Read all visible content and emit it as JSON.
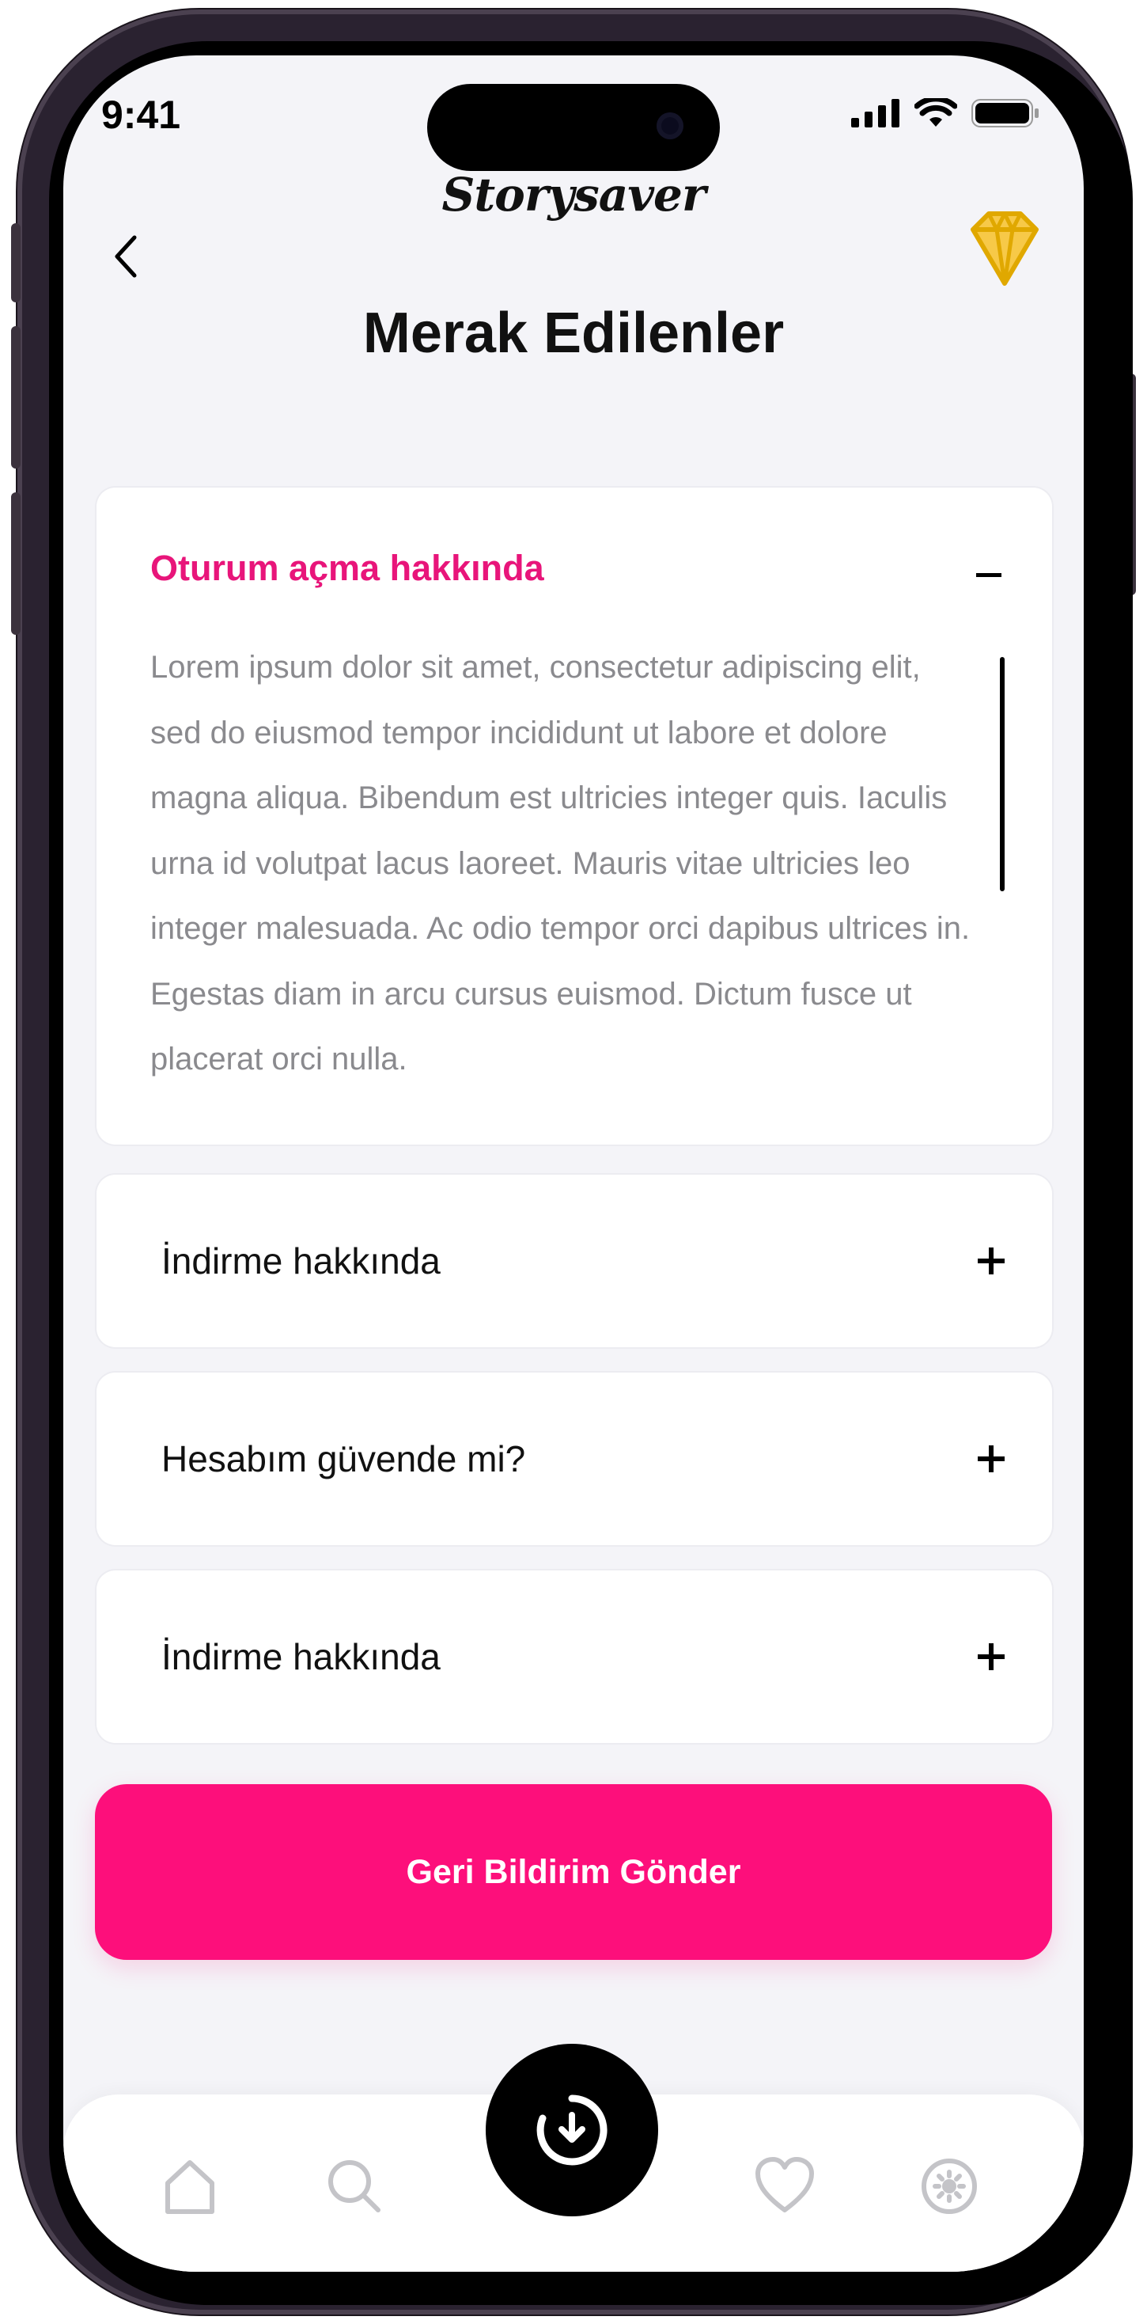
{
  "status_bar": {
    "time": "9:41"
  },
  "header": {
    "logo": "Storysaver",
    "title": "Merak Edilenler"
  },
  "faq": {
    "expanded": {
      "title": "Oturum açma hakkında",
      "body": "Lorem ipsum dolor sit amet, consectetur adipiscing elit, sed do eiusmod tempor incididunt ut labore et dolore magna aliqua. Bibendum est ultricies integer quis. Iaculis urna id volutpat lacus laoreet. Mauris vitae ultricies leo integer malesuada. Ac odio tempor orci dapibus ultrices in. Egestas diam in arcu cursus euismod. Dictum fusce ut placerat orci nulla."
    },
    "items": [
      {
        "label": "İndirme hakkında"
      },
      {
        "label": "Hesabım güvende mi?"
      },
      {
        "label": "İndirme hakkında"
      }
    ]
  },
  "cta": {
    "label": "Geri Bildirim Gönder"
  },
  "colors": {
    "accent": "#fd0f7b",
    "title_pink": "#e8157a",
    "premium_gold": "#f5c400"
  },
  "icons": {
    "back": "chevron-left-icon",
    "premium": "diamond-icon",
    "tabs": [
      "home-icon",
      "search-icon",
      "download-icon",
      "heart-icon",
      "settings-icon"
    ]
  }
}
